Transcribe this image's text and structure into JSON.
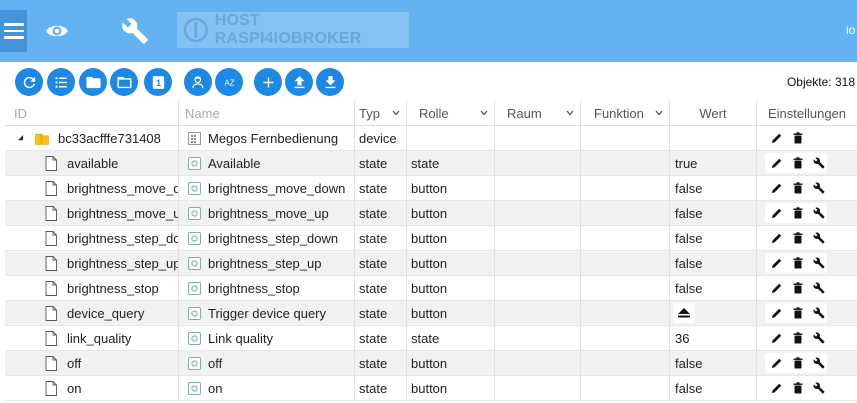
{
  "topbar": {
    "host_label": "HOST RASPI4IOBROKER",
    "user_fragment": "io"
  },
  "toolbar": {
    "buttons": [
      {
        "icon": "refresh-icon"
      },
      {
        "icon": "list-icon"
      },
      {
        "icon": "folder-filled-icon"
      },
      {
        "icon": "folder-outline-icon"
      },
      {
        "icon": "number-one-icon",
        "label": "1"
      },
      {
        "icon": "expert-user-icon"
      },
      {
        "icon": "sort-az-icon",
        "label": "AZ"
      },
      {
        "icon": "add-icon"
      },
      {
        "icon": "upload-icon"
      },
      {
        "icon": "download-icon"
      }
    ],
    "objects_count": "Objekte: 318"
  },
  "columns": {
    "id": "ID",
    "name": "Name",
    "type": "Typ",
    "role": "Rolle",
    "room": "Raum",
    "function": "Funktion",
    "value": "Wert",
    "settings": "Einstellungen"
  },
  "rows": [
    {
      "id": "bc33acfffe731408",
      "name": "Megos Fernbedienung",
      "type": "device",
      "role": "",
      "value": "",
      "kind": "device"
    },
    {
      "id": "available",
      "name": "Available",
      "type": "state",
      "role": "state",
      "value": "true",
      "kind": "state"
    },
    {
      "id": "brightness_move_down",
      "name": "brightness_move_down",
      "type": "state",
      "role": "button",
      "value": "false",
      "kind": "state"
    },
    {
      "id": "brightness_move_up",
      "name": "brightness_move_up",
      "type": "state",
      "role": "button",
      "value": "false",
      "kind": "state"
    },
    {
      "id": "brightness_step_down",
      "name": "brightness_step_down",
      "type": "state",
      "role": "button",
      "value": "false",
      "kind": "state"
    },
    {
      "id": "brightness_step_up",
      "name": "brightness_step_up",
      "type": "state",
      "role": "button",
      "value": "false",
      "kind": "state"
    },
    {
      "id": "brightness_stop",
      "name": "brightness_stop",
      "type": "state",
      "role": "button",
      "value": "false",
      "kind": "state"
    },
    {
      "id": "device_query",
      "name": "Trigger device query",
      "type": "state",
      "role": "button",
      "value": "",
      "kind": "state",
      "value_icon": "eject-icon"
    },
    {
      "id": "link_quality",
      "name": "Link quality",
      "type": "state",
      "role": "state",
      "value": "36",
      "kind": "state"
    },
    {
      "id": "off",
      "name": "off",
      "type": "state",
      "role": "button",
      "value": "false",
      "kind": "state"
    },
    {
      "id": "on",
      "name": "on",
      "type": "state",
      "role": "button",
      "value": "false",
      "kind": "state"
    }
  ],
  "colors": {
    "topbar": "#65b2f3",
    "accent": "#1e88e5",
    "folder": "#f5c518"
  }
}
